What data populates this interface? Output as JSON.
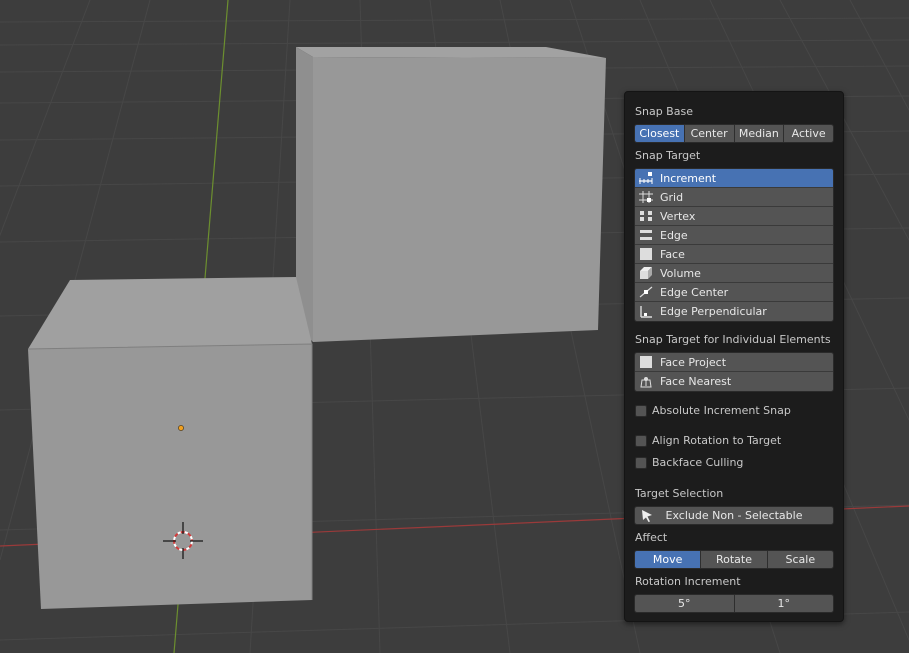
{
  "snap_base": {
    "label": "Snap Base",
    "options": [
      "Closest",
      "Center",
      "Median",
      "Active"
    ],
    "selected": "Closest"
  },
  "snap_target": {
    "label": "Snap Target",
    "items": [
      {
        "label": "Increment",
        "icon": "increment-icon",
        "selected": true
      },
      {
        "label": "Grid",
        "icon": "grid-icon",
        "selected": false
      },
      {
        "label": "Vertex",
        "icon": "vertex-icon",
        "selected": false
      },
      {
        "label": "Edge",
        "icon": "edge-icon",
        "selected": false
      },
      {
        "label": "Face",
        "icon": "face-icon",
        "selected": false
      },
      {
        "label": "Volume",
        "icon": "volume-icon",
        "selected": false
      },
      {
        "label": "Edge Center",
        "icon": "edge-center-icon",
        "selected": false
      },
      {
        "label": "Edge Perpendicular",
        "icon": "edge-perpendicular-icon",
        "selected": false
      }
    ]
  },
  "snap_individual": {
    "label": "Snap Target for Individual Elements",
    "items": [
      {
        "label": "Face Project",
        "icon": "face-project-icon",
        "selected": false
      },
      {
        "label": "Face Nearest",
        "icon": "face-nearest-icon",
        "selected": false
      }
    ]
  },
  "checkboxes": {
    "absolute_increment": {
      "label": "Absolute Increment Snap",
      "checked": false
    },
    "align_rotation": {
      "label": "Align Rotation to Target",
      "checked": false
    },
    "backface_culling": {
      "label": "Backface Culling",
      "checked": false
    }
  },
  "target_selection": {
    "label": "Target Selection",
    "value": "Exclude Non - Selectable"
  },
  "affect": {
    "label": "Affect",
    "options": [
      "Move",
      "Rotate",
      "Scale"
    ],
    "selected": "Move"
  },
  "rotation_increment": {
    "label": "Rotation Increment",
    "values": [
      "5°",
      "1°"
    ]
  },
  "colors": {
    "accent": "#4772b3",
    "button": "#545454",
    "panel": "#1c1c1c",
    "viewport": "#3d3d3d",
    "x_axis": "#9a3a3a",
    "y_axis": "#6c8f2f",
    "origin": "#f0a020"
  }
}
